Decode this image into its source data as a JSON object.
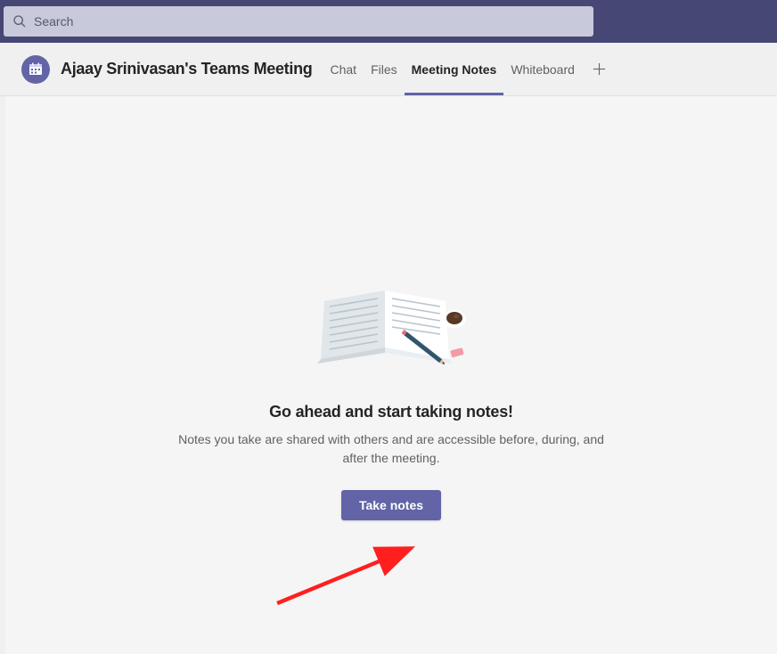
{
  "search": {
    "placeholder": "Search"
  },
  "header": {
    "title": "Ajaay Srinivasan's Teams Meeting"
  },
  "tabs": [
    {
      "label": "Chat",
      "active": false
    },
    {
      "label": "Files",
      "active": false
    },
    {
      "label": "Meeting Notes",
      "active": true
    },
    {
      "label": "Whiteboard",
      "active": false
    }
  ],
  "empty": {
    "title": "Go ahead and start taking notes!",
    "description": "Notes you take are shared with others and are accessible before, during, and after the meeting.",
    "button": "Take notes"
  }
}
